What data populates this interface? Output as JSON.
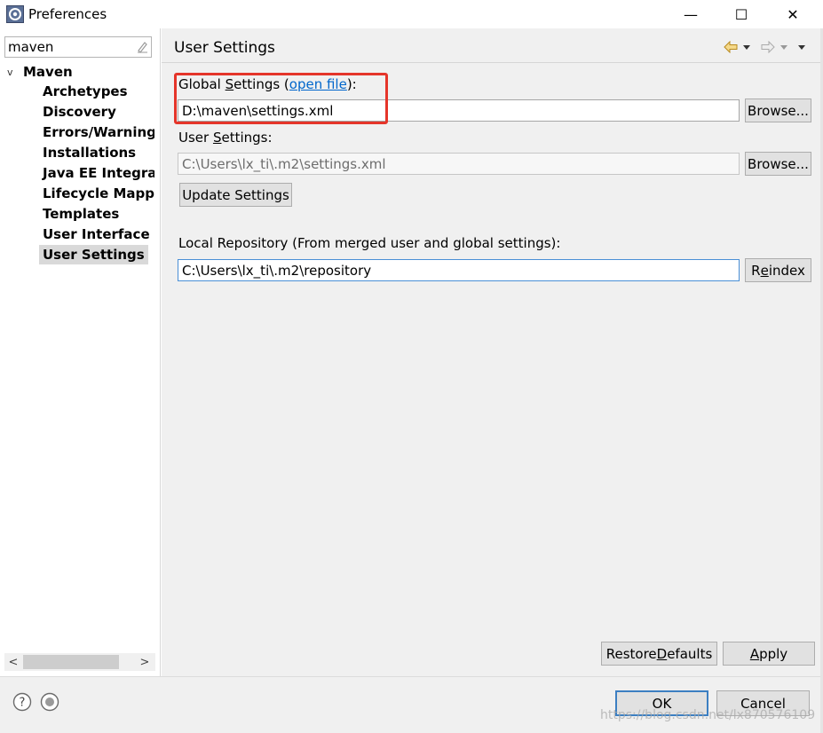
{
  "window": {
    "title": "Preferences",
    "minimize_glyph": "—",
    "maximize_glyph": "☐",
    "close_glyph": "✕"
  },
  "sidebar": {
    "filter_value": "maven",
    "tree": {
      "root_label": "Maven",
      "children": [
        {
          "label": "Archetypes"
        },
        {
          "label": "Discovery"
        },
        {
          "label": "Errors/Warnings"
        },
        {
          "label": "Installations"
        },
        {
          "label": "Java EE Integration"
        },
        {
          "label": "Lifecycle Mappings"
        },
        {
          "label": "Templates"
        },
        {
          "label": "User Interface"
        },
        {
          "label": "User Settings",
          "selected": true
        }
      ]
    },
    "scroll_left_glyph": "<",
    "scroll_right_glyph": ">"
  },
  "page": {
    "title": "User Settings",
    "global_settings": {
      "label_prefix": "Global ",
      "label_mnemonic": "S",
      "label_rest": "ettings (",
      "link": "open file",
      "label_suffix": "):",
      "value": "D:\\maven\\settings.xml",
      "browse": "Browse..."
    },
    "user_settings": {
      "label_prefix": "User ",
      "label_mnemonic": "S",
      "label_rest": "ettings:",
      "value": "C:\\Users\\lx_ti\\.m2\\settings.xml",
      "browse": "Browse..."
    },
    "update_button": "Update Settings",
    "local_repository": {
      "label": "Local Repository (From merged user and global settings):",
      "value": "C:\\Users\\lx_ti\\.m2\\repository",
      "reindex_prefix": "R",
      "reindex_mnemonic": "e",
      "reindex_rest": "index"
    },
    "restore_defaults_prefix": "Restore ",
    "restore_defaults_mnemonic": "D",
    "restore_defaults_rest": "efaults",
    "apply_mnemonic": "A",
    "apply_rest": "pply"
  },
  "footer": {
    "ok": "OK",
    "cancel": "Cancel",
    "help_glyph": "?",
    "watermark": "https://blog.csdn.net/lx870576109"
  },
  "colors": {
    "highlight": "#e5352a",
    "link": "#0066cc",
    "focus": "#3c7fc2"
  }
}
